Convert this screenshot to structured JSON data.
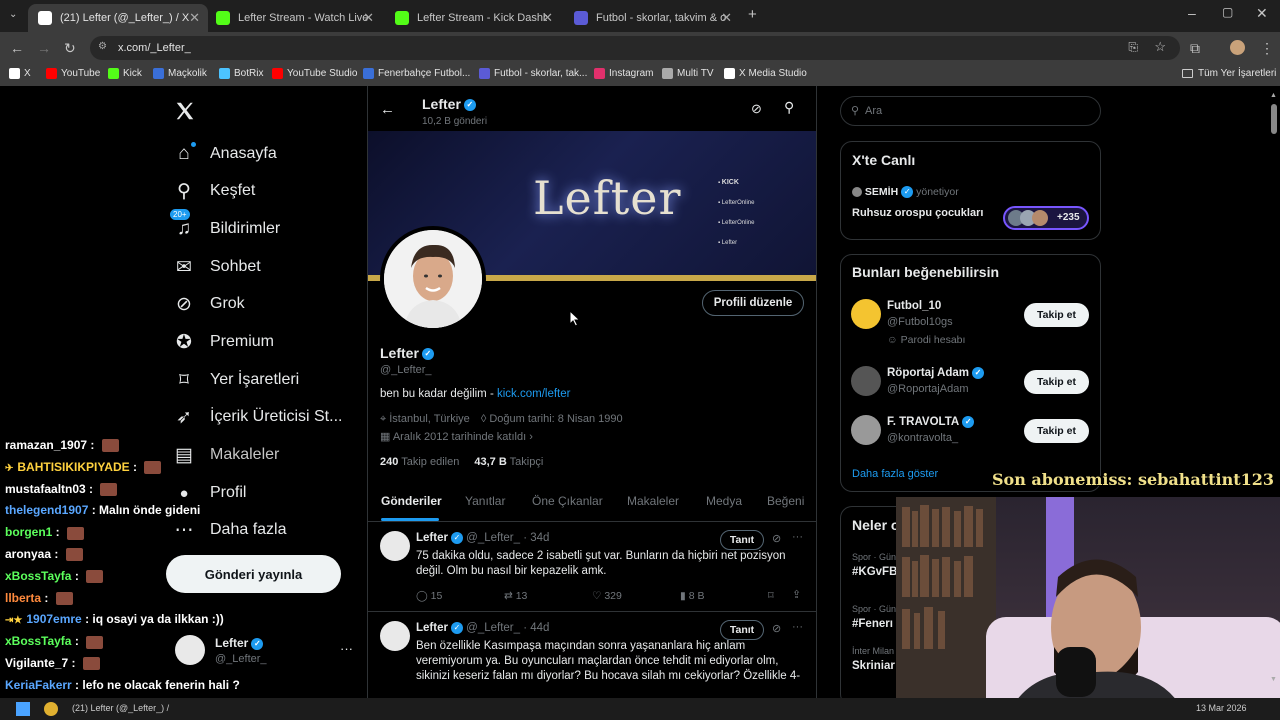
{
  "browser": {
    "tabs": [
      {
        "title": "(21) Lefter (@_Lefter_) / X",
        "icon": "x-logo-icon",
        "color": "#ffffff",
        "active": true
      },
      {
        "title": "Lefter Stream - Watch Live on K",
        "icon": "kick-icon",
        "color": "#53fc18"
      },
      {
        "title": "Lefter Stream - Kick Dashboard",
        "icon": "kick-icon",
        "color": "#53fc18"
      },
      {
        "title": "Futbol - skorlar, takvim & oranl",
        "icon": "futbol-icon",
        "color": "#5b5bd6"
      }
    ],
    "url": "x.com/_Lefter_",
    "bookmarks": [
      {
        "label": "X",
        "color": "#ffffff"
      },
      {
        "label": "YouTube",
        "color": "#ff0000"
      },
      {
        "label": "Kick",
        "color": "#53fc18"
      },
      {
        "label": "Maçkolik",
        "color": "#3a6fd8"
      },
      {
        "label": "BotRix",
        "color": "#4cc3ff"
      },
      {
        "label": "YouTube Studio",
        "color": "#ff0000"
      },
      {
        "label": "Fenerbahçe Futbol...",
        "color": "#3a6fd8"
      },
      {
        "label": "Futbol - skorlar, tak...",
        "color": "#5b5bd6"
      },
      {
        "label": "Instagram",
        "color": "#e1306c"
      },
      {
        "label": "Multi TV",
        "color": "#aaaaaa"
      },
      {
        "label": "X Media Studio",
        "color": "#ffffff"
      }
    ],
    "all_bookmarks": "Tüm Yer İşaretleri"
  },
  "nav": {
    "items": [
      {
        "label": "Anasayfa",
        "icon": "home-icon"
      },
      {
        "label": "Keşfet",
        "icon": "search-icon"
      },
      {
        "label": "Bildirimler",
        "icon": "bell-icon",
        "badge": "20+"
      },
      {
        "label": "Sohbet",
        "icon": "mail-icon"
      },
      {
        "label": "Grok",
        "icon": "grok-icon"
      },
      {
        "label": "Premium",
        "icon": "verified-icon"
      },
      {
        "label": "Yer İşaretleri",
        "icon": "bookmark-icon"
      },
      {
        "label": "İçerik Üreticisi St...",
        "icon": "rocket-icon"
      },
      {
        "label": "Makaleler",
        "icon": "article-icon"
      },
      {
        "label": "Profil",
        "icon": "person-icon"
      },
      {
        "label": "Daha fazla",
        "icon": "more-icon"
      }
    ],
    "post_button": "Gönderi yayınla",
    "account": {
      "name": "Lefter",
      "handle": "@_Lefter_"
    }
  },
  "profile": {
    "header_name": "Lefter",
    "post_count": "10,2 B gönderi",
    "banner_title": "Lefter",
    "banner_links": [
      "KICK",
      "LefterOnline",
      "LefterOnline",
      "Lefter"
    ],
    "edit_button": "Profili düzenle",
    "name": "Lefter",
    "handle": "@_Lefter_",
    "bio_text": "ben bu kadar değilim - ",
    "bio_link": "kick.com/lefter",
    "location": "İstanbul, Türkiye",
    "birthday": "Doğum tarihi: 8 Nisan 1990",
    "joined": "Aralık 2012 tarihinde katıldı",
    "following_count": "240",
    "following_label": "Takip edilen",
    "followers_count": "43,7 B",
    "followers_label": "Takipçi",
    "tabs": [
      "Gönderiler",
      "Yanıtlar",
      "Öne Çıkanlar",
      "Makaleler",
      "Medya",
      "Beğeni"
    ]
  },
  "tweets": [
    {
      "name": "Lefter",
      "handle": "@_Lefter_",
      "time": "· 34d",
      "promote": "Tanıt",
      "text": "75 dakika oldu, sadece 2 isabetli şut var. Bunların da hiçbiri net pozisyon değil. Olm bu nasıl bir kepazelik amk.",
      "replies": "15",
      "reposts": "13",
      "likes": "329",
      "views": "8 B"
    },
    {
      "name": "Lefter",
      "handle": "@_Lefter_",
      "time": "· 44d",
      "promote": "Tanıt",
      "text": "Ben özellikle Kasımpaşa maçından sonra yaşananlara hiç anlam veremiyorum ya. Bu oyuncuları maçlardan önce tehdit mi ediyorlar olm, sikinizi keseriz falan mı diyorlar? Bu hocava silah mı cekiyorlar? Özellikle 4-"
    }
  ],
  "right": {
    "search_placeholder": "Ara",
    "live_title": "X'te Canlı",
    "live_host": "SEMİH",
    "live_host_role": "yönetiyor",
    "live_topic": "Ruhsuz orospu çocukları",
    "live_count": "+235",
    "suggest_title": "Bunları beğenebilirsin",
    "suggestions": [
      {
        "name": "Futbol_10",
        "handle": "@Futbol10gs",
        "extra": "Parodi hesabı",
        "button": "Takip et"
      },
      {
        "name": "Röportaj Adam",
        "handle": "@RoportajAdam",
        "button": "Takip et"
      },
      {
        "name": "F. TRAVOLTA",
        "handle": "@kontravolta_",
        "button": "Takip et"
      }
    ],
    "show_more": "Daha fazla göster",
    "trends_title": "Neler o",
    "trends": [
      {
        "meta": "Spor · Gün",
        "tag": "#KGvFB"
      },
      {
        "meta": "Spor · Gün",
        "tag": "#Fenerı"
      },
      {
        "meta": "İnter Milan",
        "tag": "Skriniar"
      }
    ]
  },
  "chat": [
    {
      "user": "ramazan_1907",
      "color": "#ffffff",
      "msg": ""
    },
    {
      "user": "BAHTISIKIKPIYADE",
      "color": "#ffd23f",
      "msg": ""
    },
    {
      "user": "mustafaaltn03",
      "color": "#ffffff",
      "msg": ""
    },
    {
      "user": "thelegend1907",
      "color": "#5aa7ff",
      "msg": "Malın önde gideni"
    },
    {
      "user": "borgen1",
      "color": "#5cff5c",
      "msg": ""
    },
    {
      "user": "aronyaa",
      "color": "#ffffff",
      "msg": ""
    },
    {
      "user": "xBossTayfa",
      "color": "#5cff5c",
      "msg": ""
    },
    {
      "user": "llberta",
      "color": "#ff8a3d",
      "msg": ""
    },
    {
      "user": "1907emre",
      "color": "#5aa7ff",
      "msg": "iq osayi ya da ilkkan :))"
    },
    {
      "user": "xBossTayfa",
      "color": "#5cff5c",
      "msg": ""
    },
    {
      "user": "Vigilante_7",
      "color": "#ffffff",
      "msg": ""
    },
    {
      "user": "KeriaFakerr",
      "color": "#5aa7ff",
      "msg": "lefo ne olacak fenerin hali ?"
    },
    {
      "user": "xBossTayfa",
      "color": "#5cff5c",
      "msg": ""
    }
  ],
  "overlay": {
    "sub_text": "Son abonemiss: sebahattint123"
  },
  "taskbar": {
    "window_title": "(21) Lefter (@_Lefter_) /",
    "date": "13 Mar 2026"
  }
}
